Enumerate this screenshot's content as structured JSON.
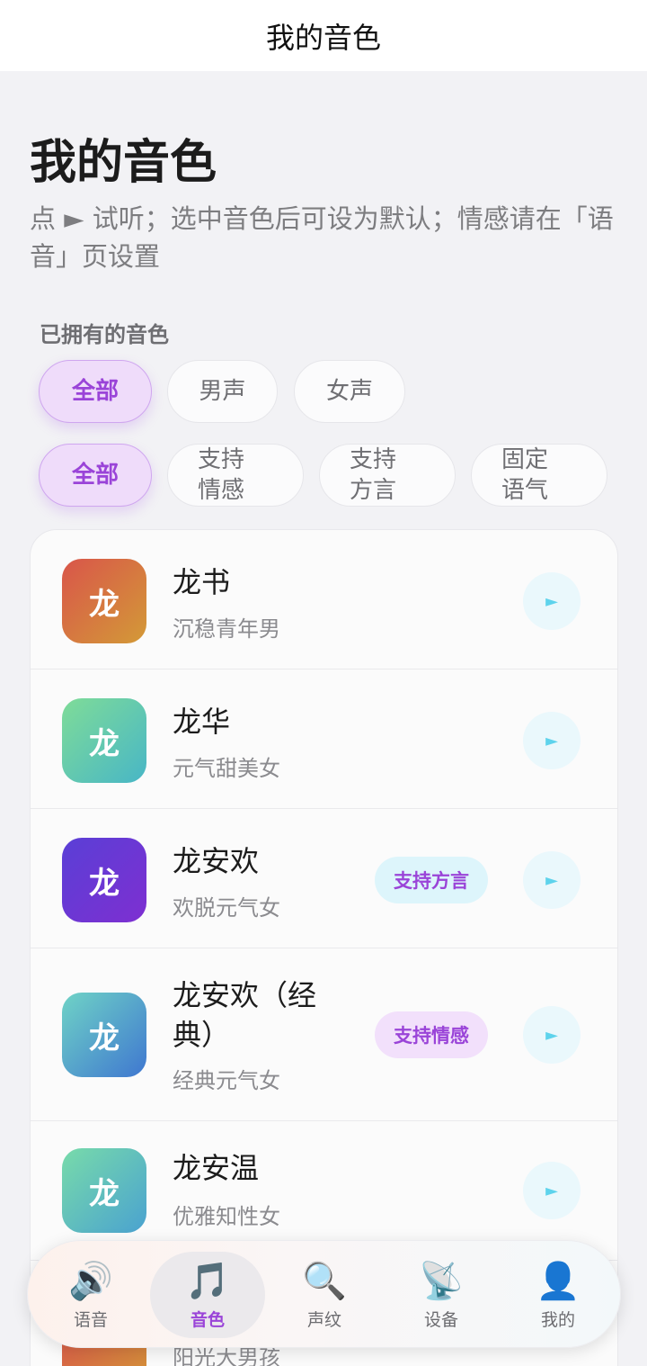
{
  "navbar": {
    "title": "我的音色"
  },
  "header": {
    "title": "我的音色",
    "description": "点 ► 试听；选中音色后可设为默认；情感请在「语音」页设置"
  },
  "filters": {
    "section_label": "已拥有的音色",
    "gender": [
      "全部",
      "男声",
      "女声"
    ],
    "feature": [
      "全部",
      "支持情感",
      "支持方言",
      "固定语气"
    ],
    "selected_gender": "全部",
    "selected_feature": "全部"
  },
  "voices": [
    {
      "avatar": "龙",
      "name": "龙书",
      "desc": "沉稳青年男",
      "tag": "",
      "play": "►"
    },
    {
      "avatar": "龙",
      "name": "龙华",
      "desc": "元气甜美女",
      "tag": "",
      "play": "►"
    },
    {
      "avatar": "龙",
      "name": "龙安欢",
      "desc": "欢脱元气女",
      "tag": "支持方言",
      "play": "►"
    },
    {
      "avatar": "龙",
      "name": "龙安欢（经典）",
      "desc": "经典元气女",
      "tag": "支持情感",
      "play": "►"
    },
    {
      "avatar": "龙",
      "name": "龙安温",
      "desc": "优雅知性女",
      "tag": "",
      "play": "►"
    },
    {
      "avatar": "",
      "name": "",
      "desc": "阳光大男孩",
      "tag": "",
      "play": ""
    }
  ],
  "avatar_gradients": [
    [
      "#d9554a",
      "#d39a37"
    ],
    [
      "#7fdc98",
      "#48b6c6"
    ],
    [
      "#5a3fd6",
      "#7e2fd1"
    ],
    [
      "#6fd3c6",
      "#3f77d0"
    ],
    [
      "#78dbaa",
      "#4aa2d0"
    ],
    [
      "#d9554a",
      "#d39a37"
    ]
  ],
  "tabbar": {
    "items": [
      {
        "icon": "🔊",
        "icon_name": "speaker-icon",
        "label": "语音"
      },
      {
        "icon": "🎵",
        "icon_name": "music-note-icon",
        "label": "音色"
      },
      {
        "icon": "🔍",
        "icon_name": "magnifier-icon",
        "label": "声纹"
      },
      {
        "icon": "📡",
        "icon_name": "satellite-dish-icon",
        "label": "设备"
      },
      {
        "icon": "👤",
        "icon_name": "user-icon",
        "label": "我的"
      }
    ],
    "active": "音色"
  },
  "colors": {
    "accent": "#9a44d8",
    "chip_active_bg": "#efdcfa",
    "play_icon": "#5ed3ec",
    "background": "#f2f2f5"
  }
}
